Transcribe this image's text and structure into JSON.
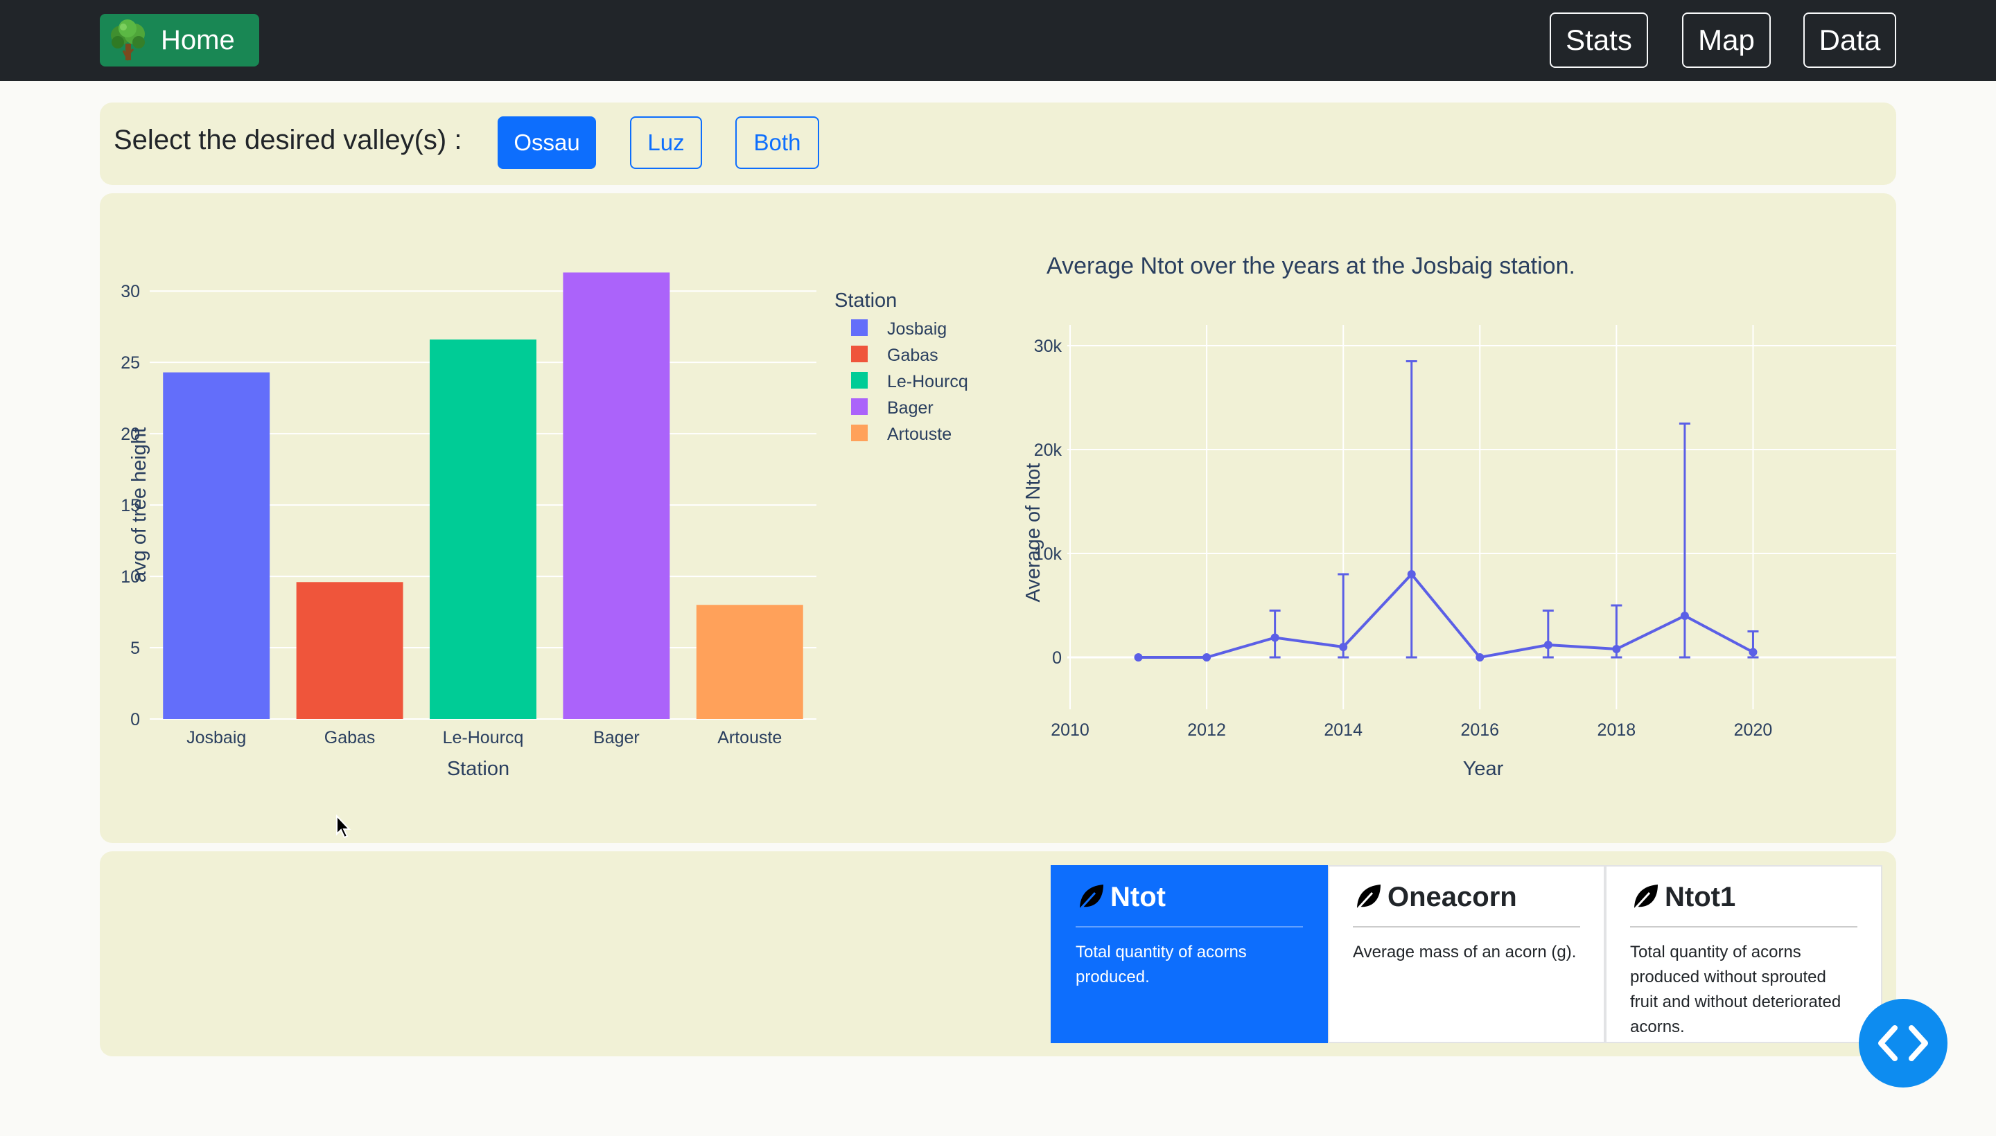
{
  "nav": {
    "home_label": "Home",
    "links": [
      "Stats",
      "Map",
      "Data"
    ]
  },
  "selector": {
    "label": "Select the desired valley(s) :",
    "options": [
      "Ossau",
      "Luz",
      "Both"
    ],
    "selected": "Ossau"
  },
  "colors": {
    "accent": "#0d6efd",
    "navbar": "#212529",
    "panel": "#f1f1d6",
    "home": "#198754",
    "line": "#5b5fe6"
  },
  "chart_data": [
    {
      "type": "bar",
      "title": "",
      "xlabel": "Station",
      "ylabel": "avg of tree height",
      "categories": [
        "Josbaig",
        "Gabas",
        "Le-Hourcq",
        "Bager",
        "Artouste"
      ],
      "values": [
        24.3,
        9.6,
        26.6,
        31.3,
        8.0
      ],
      "colors": [
        "#636efa",
        "#ef553b",
        "#00cc96",
        "#ab63fa",
        "#ffa15a"
      ],
      "ylim": [
        0,
        32
      ],
      "yticks": [
        0,
        5,
        10,
        15,
        20,
        25,
        30
      ],
      "legend": {
        "title": "Station",
        "entries": [
          "Josbaig",
          "Gabas",
          "Le-Hourcq",
          "Bager",
          "Artouste"
        ],
        "position": "right"
      },
      "grid": true
    },
    {
      "type": "line",
      "title": "Average Ntot over the years at the Josbaig station.",
      "xlabel": "Year",
      "ylabel": "Average of Ntot",
      "x": [
        2011,
        2012,
        2013,
        2014,
        2015,
        2016,
        2017,
        2018,
        2019,
        2020
      ],
      "y": [
        0,
        0,
        1900,
        1000,
        8000,
        0,
        1200,
        800,
        4000,
        500
      ],
      "error_upper": [
        0,
        0,
        4500,
        8000,
        28500,
        0,
        4500,
        5000,
        22500,
        2500
      ],
      "error_lower": [
        0,
        0,
        0,
        0,
        0,
        0,
        0,
        0,
        0,
        0
      ],
      "xticks": [
        2010,
        2012,
        2014,
        2016,
        2018,
        2020
      ],
      "yticks": [
        0,
        10000,
        20000,
        30000
      ],
      "ytick_labels": [
        "0",
        "10k",
        "20k",
        "30k"
      ],
      "xlim": [
        2010,
        2021
      ],
      "ylim": [
        -5000,
        32000
      ],
      "color": "#5b5fe6",
      "grid": true
    }
  ],
  "cards": [
    {
      "title": "Ntot",
      "text": "Total quantity of acorns produced.",
      "active": true,
      "icon": "leaf-icon"
    },
    {
      "title": "Oneacorn",
      "text": "Average mass of an acorn (g).",
      "active": false,
      "icon": "leaf-icon"
    },
    {
      "title": "Ntot1",
      "text": "Total quantity of acorns produced without sprouted fruit and without deteriorated acorns.",
      "active": false,
      "icon": "leaf-icon"
    }
  ],
  "floating_button": {
    "icon": "code-icon"
  }
}
